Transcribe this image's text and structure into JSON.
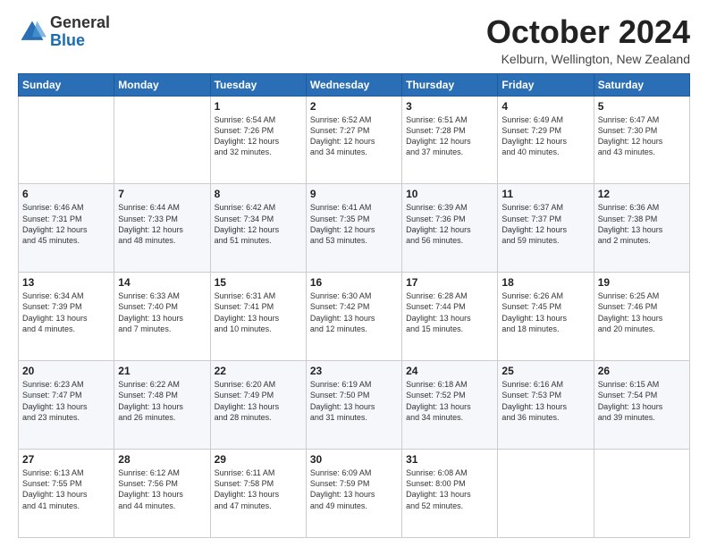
{
  "header": {
    "logo_general": "General",
    "logo_blue": "Blue",
    "month_title": "October 2024",
    "location": "Kelburn, Wellington, New Zealand"
  },
  "days_of_week": [
    "Sunday",
    "Monday",
    "Tuesday",
    "Wednesday",
    "Thursday",
    "Friday",
    "Saturday"
  ],
  "weeks": [
    [
      {
        "day": "",
        "info": ""
      },
      {
        "day": "",
        "info": ""
      },
      {
        "day": "1",
        "info": "Sunrise: 6:54 AM\nSunset: 7:26 PM\nDaylight: 12 hours\nand 32 minutes."
      },
      {
        "day": "2",
        "info": "Sunrise: 6:52 AM\nSunset: 7:27 PM\nDaylight: 12 hours\nand 34 minutes."
      },
      {
        "day": "3",
        "info": "Sunrise: 6:51 AM\nSunset: 7:28 PM\nDaylight: 12 hours\nand 37 minutes."
      },
      {
        "day": "4",
        "info": "Sunrise: 6:49 AM\nSunset: 7:29 PM\nDaylight: 12 hours\nand 40 minutes."
      },
      {
        "day": "5",
        "info": "Sunrise: 6:47 AM\nSunset: 7:30 PM\nDaylight: 12 hours\nand 43 minutes."
      }
    ],
    [
      {
        "day": "6",
        "info": "Sunrise: 6:46 AM\nSunset: 7:31 PM\nDaylight: 12 hours\nand 45 minutes."
      },
      {
        "day": "7",
        "info": "Sunrise: 6:44 AM\nSunset: 7:33 PM\nDaylight: 12 hours\nand 48 minutes."
      },
      {
        "day": "8",
        "info": "Sunrise: 6:42 AM\nSunset: 7:34 PM\nDaylight: 12 hours\nand 51 minutes."
      },
      {
        "day": "9",
        "info": "Sunrise: 6:41 AM\nSunset: 7:35 PM\nDaylight: 12 hours\nand 53 minutes."
      },
      {
        "day": "10",
        "info": "Sunrise: 6:39 AM\nSunset: 7:36 PM\nDaylight: 12 hours\nand 56 minutes."
      },
      {
        "day": "11",
        "info": "Sunrise: 6:37 AM\nSunset: 7:37 PM\nDaylight: 12 hours\nand 59 minutes."
      },
      {
        "day": "12",
        "info": "Sunrise: 6:36 AM\nSunset: 7:38 PM\nDaylight: 13 hours\nand 2 minutes."
      }
    ],
    [
      {
        "day": "13",
        "info": "Sunrise: 6:34 AM\nSunset: 7:39 PM\nDaylight: 13 hours\nand 4 minutes."
      },
      {
        "day": "14",
        "info": "Sunrise: 6:33 AM\nSunset: 7:40 PM\nDaylight: 13 hours\nand 7 minutes."
      },
      {
        "day": "15",
        "info": "Sunrise: 6:31 AM\nSunset: 7:41 PM\nDaylight: 13 hours\nand 10 minutes."
      },
      {
        "day": "16",
        "info": "Sunrise: 6:30 AM\nSunset: 7:42 PM\nDaylight: 13 hours\nand 12 minutes."
      },
      {
        "day": "17",
        "info": "Sunrise: 6:28 AM\nSunset: 7:44 PM\nDaylight: 13 hours\nand 15 minutes."
      },
      {
        "day": "18",
        "info": "Sunrise: 6:26 AM\nSunset: 7:45 PM\nDaylight: 13 hours\nand 18 minutes."
      },
      {
        "day": "19",
        "info": "Sunrise: 6:25 AM\nSunset: 7:46 PM\nDaylight: 13 hours\nand 20 minutes."
      }
    ],
    [
      {
        "day": "20",
        "info": "Sunrise: 6:23 AM\nSunset: 7:47 PM\nDaylight: 13 hours\nand 23 minutes."
      },
      {
        "day": "21",
        "info": "Sunrise: 6:22 AM\nSunset: 7:48 PM\nDaylight: 13 hours\nand 26 minutes."
      },
      {
        "day": "22",
        "info": "Sunrise: 6:20 AM\nSunset: 7:49 PM\nDaylight: 13 hours\nand 28 minutes."
      },
      {
        "day": "23",
        "info": "Sunrise: 6:19 AM\nSunset: 7:50 PM\nDaylight: 13 hours\nand 31 minutes."
      },
      {
        "day": "24",
        "info": "Sunrise: 6:18 AM\nSunset: 7:52 PM\nDaylight: 13 hours\nand 34 minutes."
      },
      {
        "day": "25",
        "info": "Sunrise: 6:16 AM\nSunset: 7:53 PM\nDaylight: 13 hours\nand 36 minutes."
      },
      {
        "day": "26",
        "info": "Sunrise: 6:15 AM\nSunset: 7:54 PM\nDaylight: 13 hours\nand 39 minutes."
      }
    ],
    [
      {
        "day": "27",
        "info": "Sunrise: 6:13 AM\nSunset: 7:55 PM\nDaylight: 13 hours\nand 41 minutes."
      },
      {
        "day": "28",
        "info": "Sunrise: 6:12 AM\nSunset: 7:56 PM\nDaylight: 13 hours\nand 44 minutes."
      },
      {
        "day": "29",
        "info": "Sunrise: 6:11 AM\nSunset: 7:58 PM\nDaylight: 13 hours\nand 47 minutes."
      },
      {
        "day": "30",
        "info": "Sunrise: 6:09 AM\nSunset: 7:59 PM\nDaylight: 13 hours\nand 49 minutes."
      },
      {
        "day": "31",
        "info": "Sunrise: 6:08 AM\nSunset: 8:00 PM\nDaylight: 13 hours\nand 52 minutes."
      },
      {
        "day": "",
        "info": ""
      },
      {
        "day": "",
        "info": ""
      }
    ]
  ]
}
